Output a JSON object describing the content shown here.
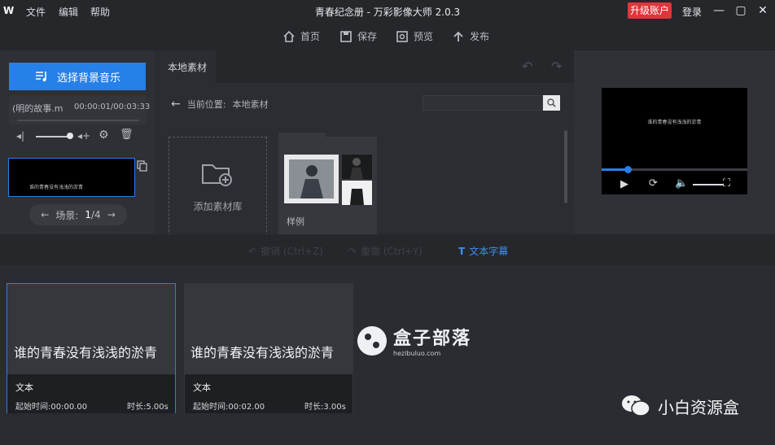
{
  "app": {
    "logo_text": "W",
    "title": "青春纪念册 - 万彩影像大师 2.0.3",
    "menu": [
      "文件",
      "编辑",
      "帮助"
    ],
    "upgrade_label": "升级账户",
    "login_label": "登录"
  },
  "toolbar": {
    "home": "首页",
    "save": "保存",
    "preview": "预览",
    "publish": "发布"
  },
  "left": {
    "music_button": "选择背景音乐",
    "music_name": "(明的故事.m",
    "music_time": "00:00:01/00:03:33",
    "scene_label": "场景:",
    "scene_current": "1",
    "scene_total": "/4",
    "scene_thumb_text": "谁的青春没有浅浅的淤青"
  },
  "center": {
    "tab_label": "本地素材",
    "location_label": "当前位置:",
    "location_value": "本地素材",
    "search_placeholder": "",
    "add_library_label": "添加素材库",
    "folder_label": "样例"
  },
  "preview": {
    "text": "谁的青春没有浅浅的淤青",
    "progress": 0.18
  },
  "editbar": {
    "undo": "撤销 (Ctrl+Z)",
    "redo": "重做 (Ctrl+Y)",
    "text_subtitle": "文本字幕"
  },
  "timeline": {
    "cards": [
      {
        "text": "谁的青春没有浅浅的淤青",
        "type": "文本",
        "start": "起始时间:00:00.00",
        "duration": "时长:5.00s"
      },
      {
        "text": "谁的青春没有浅浅的淤青",
        "type": "文本",
        "start": "起始时间:00:02.00",
        "duration": "时长:3.00s"
      }
    ]
  },
  "watermark": {
    "title": "盒子部落",
    "subtitle": "hezibuluo.com"
  },
  "brand": {
    "text": "小白资源盒"
  },
  "colors": {
    "accent": "#2680e8",
    "upgrade": "#e0353b",
    "background": "#2a2c31"
  }
}
